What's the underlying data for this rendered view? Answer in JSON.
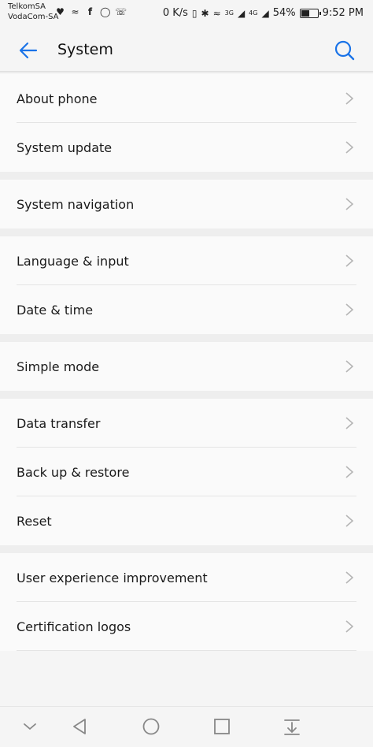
{
  "status_bar": {
    "carrier1": "TelkomSA",
    "carrier2": "VodaCom-SA",
    "speed": "0 K/s",
    "signal1": "3G",
    "signal2": "4G",
    "battery": "54%",
    "battery_level": 0.54,
    "time": "9:52 PM"
  },
  "app_bar": {
    "title": "System"
  },
  "groups": [
    {
      "items": [
        {
          "label": "About phone"
        },
        {
          "label": "System update"
        }
      ]
    },
    {
      "items": [
        {
          "label": "System navigation"
        }
      ]
    },
    {
      "items": [
        {
          "label": "Language & input"
        },
        {
          "label": "Date & time"
        }
      ]
    },
    {
      "items": [
        {
          "label": "Simple mode"
        }
      ]
    },
    {
      "items": [
        {
          "label": "Data transfer"
        },
        {
          "label": "Back up & restore"
        },
        {
          "label": "Reset"
        }
      ]
    },
    {
      "items": [
        {
          "label": "User experience improvement"
        },
        {
          "label": "Certification logos"
        }
      ]
    }
  ],
  "colors": {
    "accent": "#1a73e8",
    "text": "#1a1a1a",
    "chevron": "#b5b5b5"
  }
}
